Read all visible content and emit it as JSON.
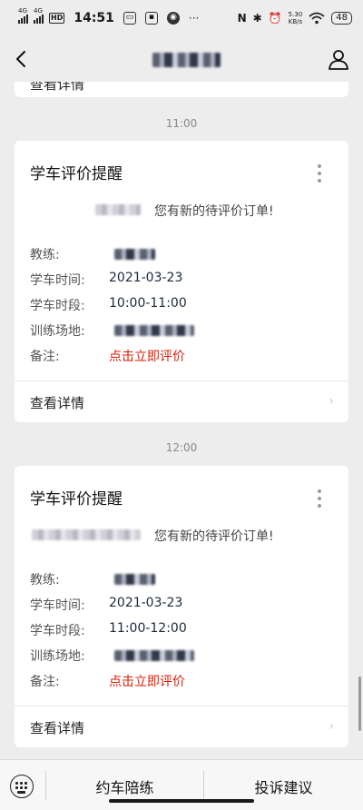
{
  "status_bar": {
    "net1": "4G",
    "net2": "4G",
    "hd": "HD",
    "time": "14:51",
    "speed_value": "5.30",
    "speed_unit": "KB/s",
    "battery": "48"
  },
  "nav": {
    "back_icon": "chevron-left-icon",
    "profile_icon": "person-icon"
  },
  "prev_card": {
    "detail_label": "查看详情"
  },
  "messages": [
    {
      "timestamp": "11:00",
      "title": "学车评价提醒",
      "text": "您有新的待评价订单!",
      "fields": [
        {
          "label": "教练:",
          "value": ""
        },
        {
          "label": "学车时间:",
          "value": "2021-03-23"
        },
        {
          "label": "学车时段:",
          "value": "10:00-11:00"
        },
        {
          "label": "训练场地:",
          "value": ""
        },
        {
          "label": "备注:",
          "value": "点击立即评价"
        }
      ],
      "detail_label": "查看详情"
    },
    {
      "timestamp": "12:00",
      "title": "学车评价提醒",
      "text": "您有新的待评价订单!",
      "fields": [
        {
          "label": "教练:",
          "value": ""
        },
        {
          "label": "学车时间:",
          "value": "2021-03-23"
        },
        {
          "label": "学车时段:",
          "value": "11:00-12:00"
        },
        {
          "label": "训练场地:",
          "value": ""
        },
        {
          "label": "备注:",
          "value": "点击立即评价"
        }
      ],
      "detail_label": "查看详情"
    }
  ],
  "bottom_menu": {
    "keyboard_icon": "keyboard-icon",
    "item1": "约车陪练",
    "item2": "投诉建议"
  },
  "colors": {
    "accent_red": "#d81e06",
    "background": "#ededed"
  }
}
